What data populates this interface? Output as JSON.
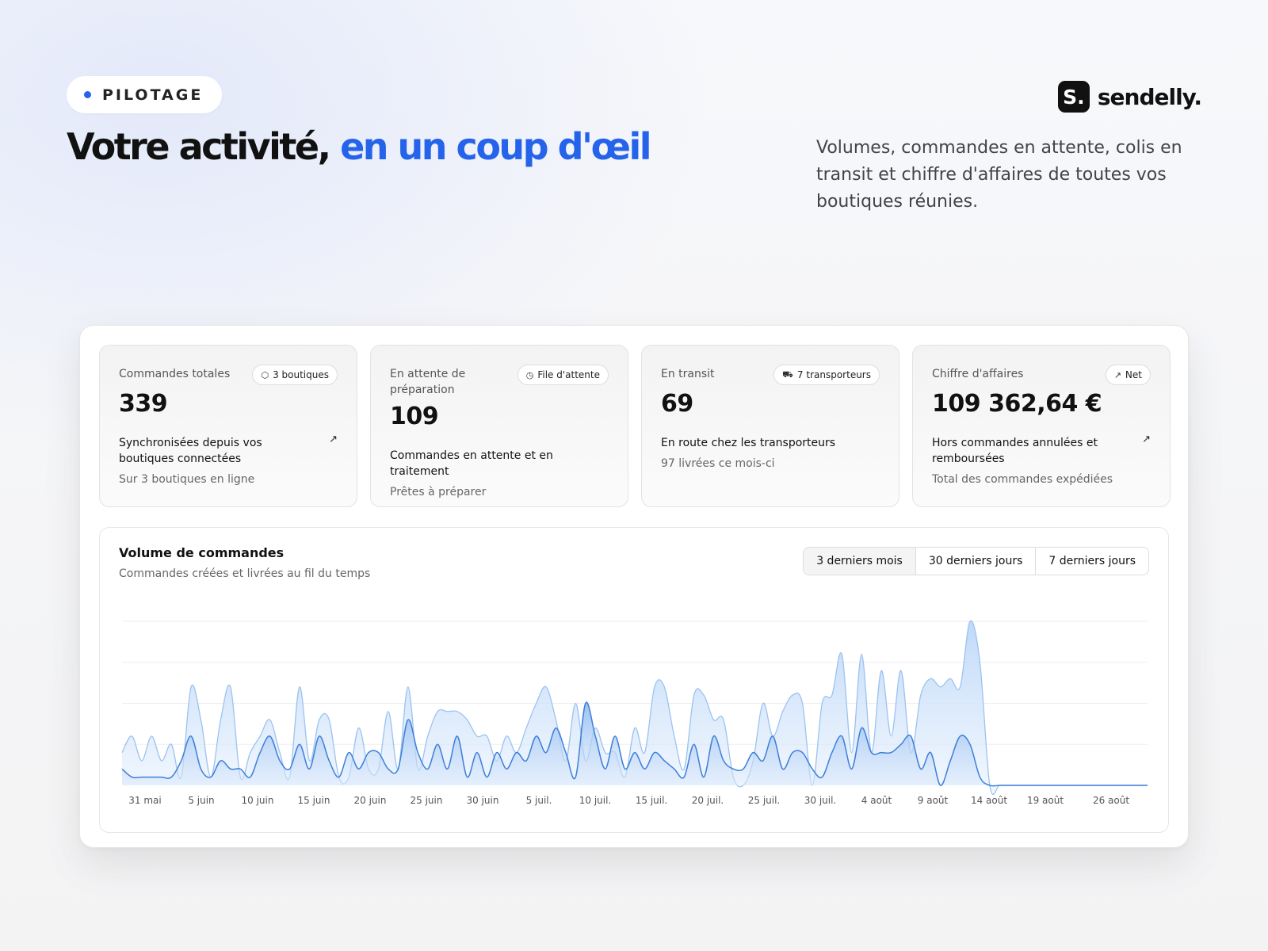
{
  "header": {
    "badge": "PILOTAGE",
    "title_main": "Votre activité, ",
    "title_accent": "en un coup d'œil",
    "intro": "Volumes, commandes en attente, colis en transit et chiffre d'affaires de toutes vos boutiques réunies.",
    "logo_mark": "S.",
    "logo_text": "sendelly."
  },
  "colors": {
    "accent": "#2563eb",
    "chart_line": "#4a8fe0",
    "chart_fill": "#cfe3fb"
  },
  "cards": [
    {
      "label": "Commandes totales",
      "pill": "3 boutiques",
      "pill_icon": "box-icon",
      "value": "339",
      "desc": "Synchronisées depuis vos boutiques connectées",
      "trend": true,
      "sub": "Sur 3 boutiques en ligne"
    },
    {
      "label": "En attente de préparation",
      "pill": "File d'attente",
      "pill_icon": "clock-icon",
      "value": "109",
      "desc": "Commandes en attente et en traitement",
      "trend": false,
      "sub": "Prêtes à préparer"
    },
    {
      "label": "En transit",
      "pill": "7 transporteurs",
      "pill_icon": "truck-icon",
      "value": "69",
      "desc": "En route chez les transporteurs",
      "trend": false,
      "sub": "97 livrées ce mois-ci"
    },
    {
      "label": "Chiffre d'affaires",
      "pill": "Net",
      "pill_icon": "trend-up-icon",
      "value": "109 362,64 €",
      "desc": "Hors commandes annulées et remboursées",
      "trend": true,
      "sub": "Total des commandes expédiées"
    }
  ],
  "chart_panel": {
    "title": "Volume de commandes",
    "subtitle": "Commandes créées et livrées au fil du temps",
    "tabs": [
      "3 derniers mois",
      "30 derniers jours",
      "7 derniers jours"
    ],
    "active_tab": "3 derniers mois"
  },
  "chart_data": {
    "type": "area",
    "x_ticks": [
      "31 mai",
      "5 juin",
      "10 juin",
      "15 juin",
      "20 juin",
      "25 juin",
      "30 juin",
      "5 juil.",
      "10 juil.",
      "15 juil.",
      "20 juil.",
      "25 juil.",
      "30 juil.",
      "4 août",
      "9 août",
      "14 août",
      "19 août",
      "26 août"
    ],
    "grid": true,
    "ylim": [
      0,
      20
    ],
    "series": [
      {
        "values": [
          4,
          6,
          3,
          6,
          3,
          5,
          1,
          12,
          8,
          1,
          8,
          12,
          1,
          4,
          6,
          8,
          4,
          1,
          12,
          3,
          8,
          8,
          1,
          1,
          7,
          2,
          2,
          9,
          2,
          12,
          2,
          6,
          9,
          9,
          9,
          8,
          6,
          6,
          3,
          6,
          4,
          7,
          10,
          12,
          8,
          3,
          10,
          3,
          7,
          4,
          4,
          1,
          7,
          4,
          12,
          12,
          6,
          2,
          11,
          11,
          8,
          8,
          1,
          0,
          3,
          10,
          6,
          9,
          11,
          10,
          0,
          10,
          11,
          16,
          4,
          16,
          4,
          14,
          6,
          14,
          4,
          11,
          13,
          12,
          13,
          12,
          20,
          15,
          0,
          0,
          0,
          0,
          0,
          0,
          0,
          0,
          0,
          0,
          0,
          0,
          0,
          0,
          0,
          0,
          0
        ]
      },
      {
        "values": [
          2,
          1,
          1,
          1,
          1,
          1,
          3,
          6,
          2,
          1,
          3,
          2,
          2,
          1,
          4,
          6,
          3,
          2,
          5,
          2,
          6,
          3,
          1,
          4,
          2,
          4,
          4,
          2,
          2,
          8,
          4,
          2,
          5,
          2,
          6,
          1,
          4,
          1,
          4,
          2,
          4,
          3,
          6,
          4,
          7,
          4,
          1,
          10,
          6,
          2,
          6,
          2,
          4,
          2,
          4,
          3,
          2,
          1,
          5,
          1,
          6,
          3,
          2,
          2,
          4,
          3,
          6,
          2,
          4,
          4,
          2,
          1,
          4,
          6,
          2,
          7,
          4,
          4,
          4,
          5,
          6,
          2,
          4,
          0,
          3,
          6,
          5,
          1,
          0,
          0,
          0,
          0,
          0,
          0,
          0,
          0,
          0,
          0,
          0,
          0,
          0,
          0,
          0,
          0,
          0
        ]
      }
    ]
  }
}
